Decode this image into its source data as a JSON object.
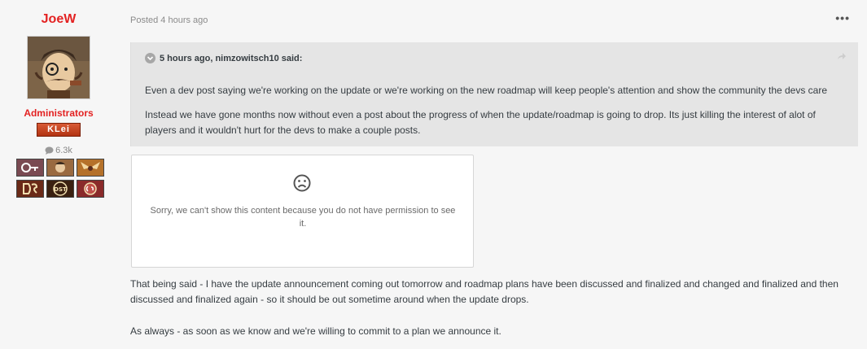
{
  "author": {
    "name": "JoeW",
    "group": "Administrators",
    "rank_badge": "KLei",
    "reputation": "6.3k",
    "badges": [
      "badge-key",
      "badge-character",
      "badge-winged",
      "badge-ds",
      "badge-dst",
      "badge-co"
    ]
  },
  "post": {
    "date": "Posted 4 hours ago",
    "more_label": "•••",
    "quote": {
      "citation": "5 hours ago, nimzowitsch10 said:",
      "paragraph1": "Even a dev post saying we're working on the update or we're working on the new roadmap will keep people's attention and show the community the devs care",
      "paragraph2": "Instead we have gone months now without even a post about the progress of when the update/roadmap is going to drop. Its just killing the interest of alot of players and it wouldn't hurt for the devs to make a couple posts."
    },
    "permission_message": "Sorry, we can't show this content because you do not have permission to see it.",
    "paragraph1": "That being said - I have the update announcement coming out tomorrow and roadmap plans have been discussed and finalized and changed and finalized and then discussed and finalized again - so it should be out sometime around when the update drops.",
    "paragraph2": "As always - as soon as we know and we're willing to commit to a plan we announce it."
  },
  "colors": {
    "author": "#e32222",
    "quote_bg": "#e5e5e5",
    "text": "#353c41"
  }
}
